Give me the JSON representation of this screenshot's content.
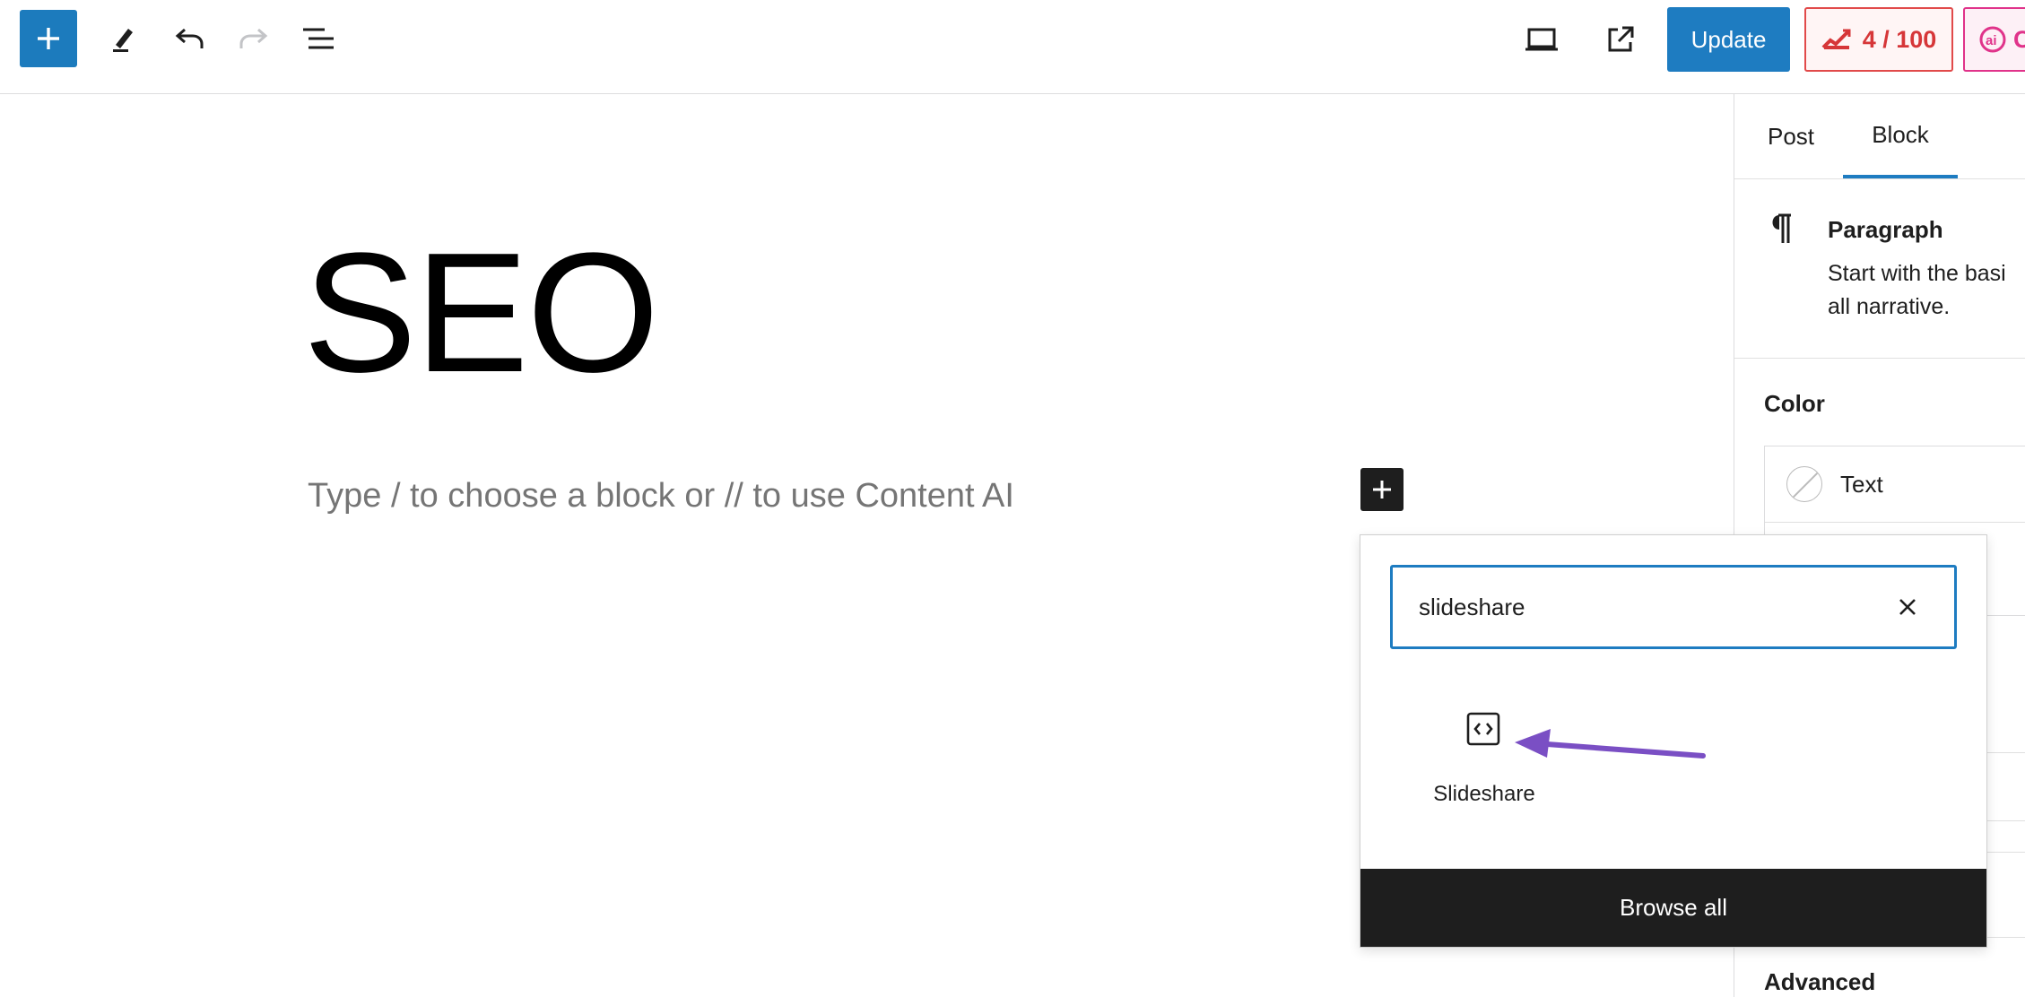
{
  "toolbar": {
    "inserter_icon": "plus-icon",
    "tools_icon": "pencil-icon",
    "undo_icon": "undo-icon",
    "redo_icon": "redo-icon",
    "list_view_icon": "list-view-icon",
    "preview_icon": "laptop-icon",
    "view_post_icon": "external-link-icon",
    "update_label": "Update",
    "seo_score": "4 / 100",
    "seo_icon": "chart-arrow-icon",
    "ai_label": "C",
    "ai_icon": "content-ai-icon"
  },
  "editor": {
    "title": "SEO",
    "placeholder": "Type / to choose a block or // to use Content AI",
    "inline_inserter_icon": "plus-icon"
  },
  "inserter": {
    "search_value": "slideshare",
    "clear_icon": "close-icon",
    "results": [
      {
        "label": "Slideshare",
        "icon": "embed-icon"
      }
    ],
    "browse_all_label": "Browse all"
  },
  "sidebar": {
    "tabs": [
      {
        "label": "Post",
        "active": false
      },
      {
        "label": "Block",
        "active": true
      }
    ],
    "block_card": {
      "icon": "paragraph-icon",
      "title": "Paragraph",
      "description_line1": "Start with the basi",
      "description_line2": "all narrative."
    },
    "color": {
      "heading": "Color",
      "text_label": "Text"
    },
    "advanced_label": "Advanced"
  },
  "colors": {
    "accent": "#1e7cc1",
    "score_red": "#d63638",
    "ai_pink": "#e0338a",
    "dark": "#1e1e1e",
    "annotation_arrow": "#7a4fc4"
  }
}
